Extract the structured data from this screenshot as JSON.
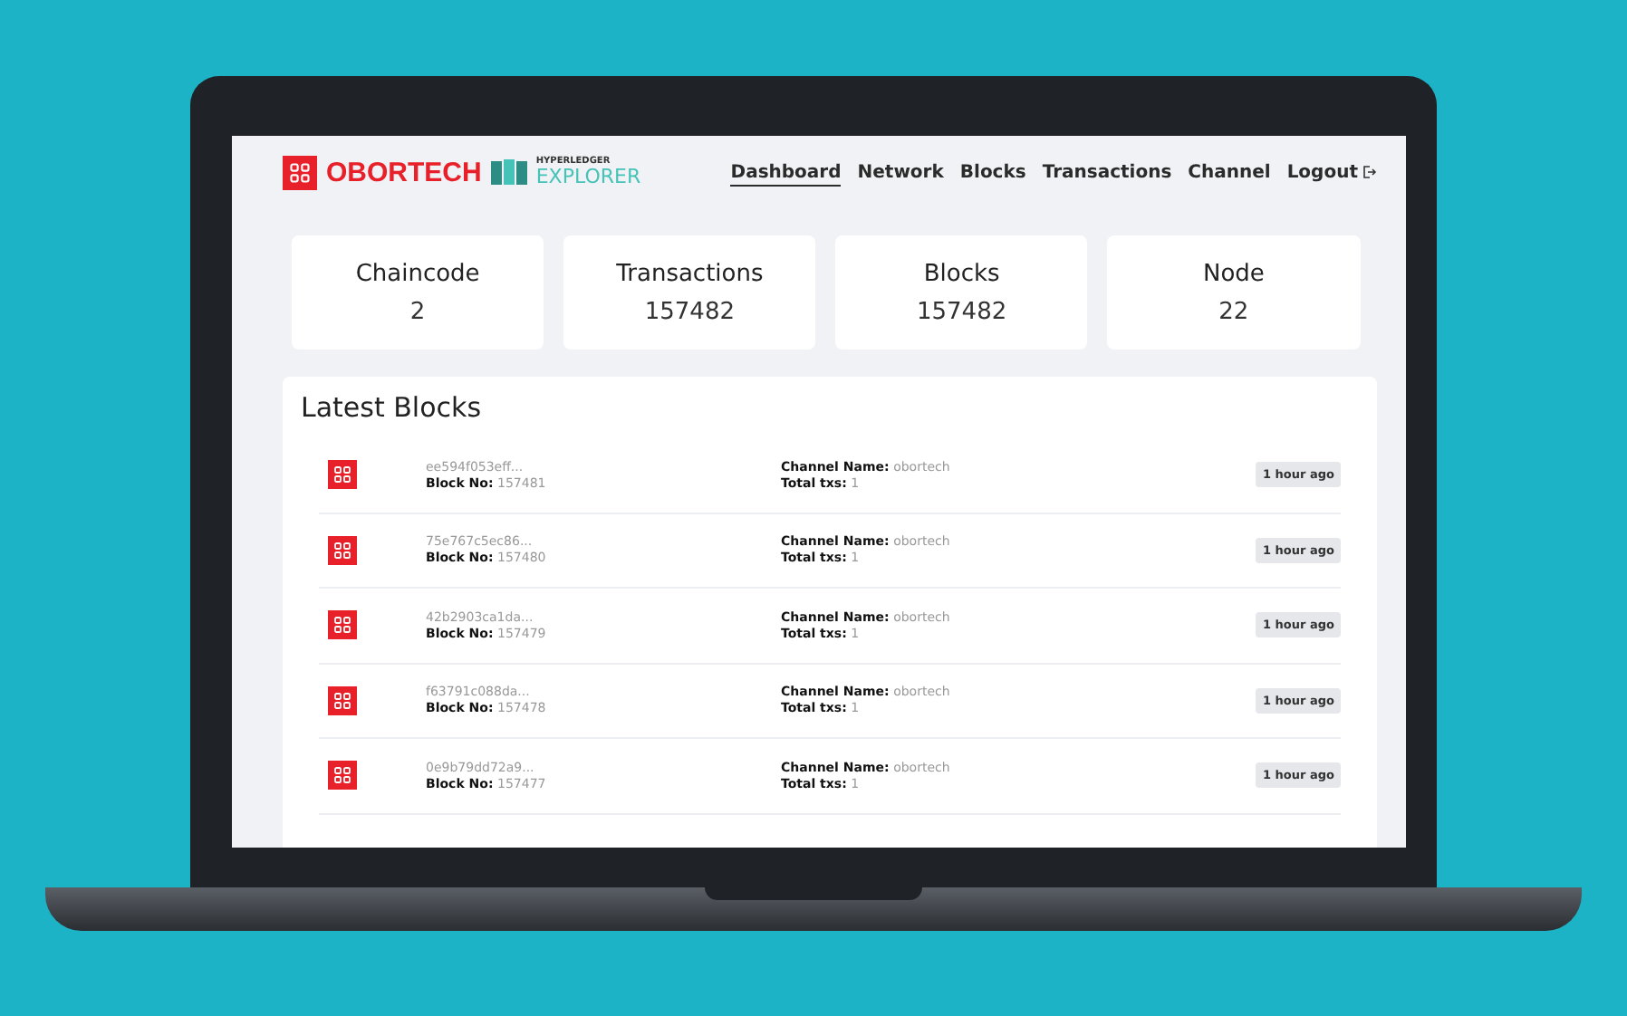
{
  "logo": {
    "brand": "OBORTECH",
    "product_top": "HYPERLEDGER",
    "product_bottom": "EXPLORER"
  },
  "nav": [
    {
      "label": "Dashboard",
      "selected": true
    },
    {
      "label": "Network",
      "selected": false
    },
    {
      "label": "Blocks",
      "selected": false
    },
    {
      "label": "Transactions",
      "selected": false
    },
    {
      "label": "Channel",
      "selected": false
    },
    {
      "label": "Logout",
      "selected": false
    }
  ],
  "stats": [
    {
      "label": "Chaincode",
      "value": "2"
    },
    {
      "label": "Transactions",
      "value": "157482"
    },
    {
      "label": "Blocks",
      "value": "157482"
    },
    {
      "label": "Node",
      "value": "22"
    }
  ],
  "latest_blocks": {
    "title": "Latest Blocks",
    "rows": [
      {
        "hash": "ee594f053eff...",
        "block_no_label": "Block No:",
        "block_no": "157481",
        "channel_label": "Channel Name:",
        "channel": "obortech",
        "txs_label": "Total txs:",
        "txs": "1",
        "time": "1 hour ago"
      },
      {
        "hash": "75e767c5ec86...",
        "block_no_label": "Block No:",
        "block_no": "157480",
        "channel_label": "Channel Name:",
        "channel": "obortech",
        "txs_label": "Total txs:",
        "txs": "1",
        "time": "1 hour ago"
      },
      {
        "hash": "42b2903ca1da...",
        "block_no_label": "Block No:",
        "block_no": "157479",
        "channel_label": "Channel Name:",
        "channel": "obortech",
        "txs_label": "Total txs:",
        "txs": "1",
        "time": "1 hour ago"
      },
      {
        "hash": "f63791c088da...",
        "block_no_label": "Block No:",
        "block_no": "157478",
        "channel_label": "Channel Name:",
        "channel": "obortech",
        "txs_label": "Total txs:",
        "txs": "1",
        "time": "1 hour ago"
      },
      {
        "hash": "0e9b79dd72a9...",
        "block_no_label": "Block No:",
        "block_no": "157477",
        "channel_label": "Channel Name:",
        "channel": "obortech",
        "txs_label": "Total txs:",
        "txs": "1",
        "time": "1 hour ago"
      }
    ]
  }
}
